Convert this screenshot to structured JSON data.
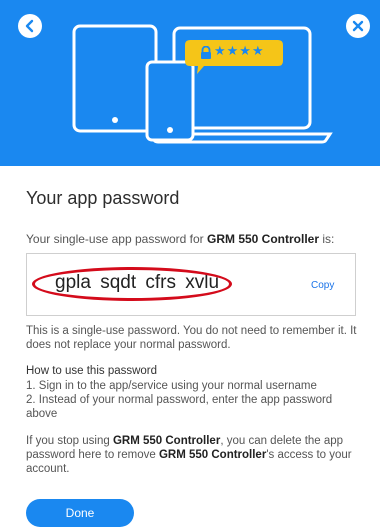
{
  "colors": {
    "accent": "#1a88f0",
    "annotation": "#d40b1b"
  },
  "nav": {
    "back_icon": "chevron-left-icon",
    "close_icon": "close-icon"
  },
  "illustration": {
    "lock_icon": "lock-icon",
    "masked_password": "★★★★"
  },
  "dialog": {
    "title": "Your app password",
    "lead_prefix": "Your single-use app password for ",
    "app_name": "GRM 550 Controller",
    "lead_suffix": " is:",
    "password": "gpla sqdt cfrs xvlu",
    "copy_label": "Copy",
    "note": "This is a single-use password. You do not need to remember it. It does not replace your normal password.",
    "how_heading": "How to use this password",
    "steps": [
      "1. Sign in to the app/service using your normal username",
      "2. Instead of your normal password, enter the app password above"
    ],
    "stop_prefix": "If you stop using ",
    "stop_middle": ", you can delete the app password here to remove ",
    "stop_suffix": "'s access to your account.",
    "done_label": "Done"
  }
}
